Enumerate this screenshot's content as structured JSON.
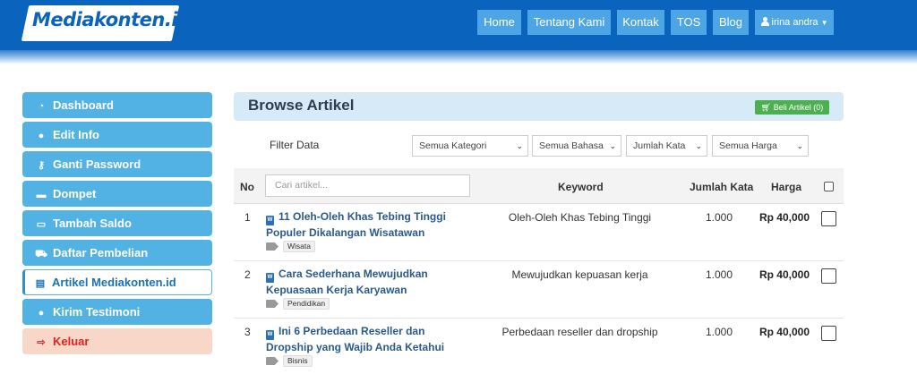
{
  "header": {
    "logo": "Mediakonten.id",
    "nav": [
      "Home",
      "Tentang Kami",
      "Kontak",
      "TOS",
      "Blog"
    ],
    "user": "irina andra"
  },
  "sidebar": {
    "items": [
      {
        "label": "Dashboard",
        "icon": "dashboard-icon"
      },
      {
        "label": "Edit Info",
        "icon": "user-icon"
      },
      {
        "label": "Ganti Password",
        "icon": "key-icon"
      },
      {
        "label": "Dompet",
        "icon": "wallet-icon"
      },
      {
        "label": "Tambah Saldo",
        "icon": "money-icon"
      },
      {
        "label": "Daftar Pembelian",
        "icon": "cart-icon"
      },
      {
        "label": "Artikel Mediakonten.id",
        "icon": "store-icon",
        "active": true
      },
      {
        "label": "Kirim Testimoni",
        "icon": "comment-icon"
      },
      {
        "label": "Keluar",
        "icon": "logout-icon"
      }
    ]
  },
  "main": {
    "title": "Browse Artikel",
    "cart_button": "Beli Artikel (0)",
    "filter_label": "Filter Data",
    "filters": [
      "Semua Kategori",
      "Semua Bahasa",
      "Jumlah Kata",
      "Semua Harga"
    ],
    "search_placeholder": "Cari artikel...",
    "columns": {
      "no": "No",
      "keyword": "Keyword",
      "words": "Jumlah Kata",
      "price": "Harga"
    },
    "rows": [
      {
        "no": "1",
        "title_1": "11 Oleh-Oleh Khas Tebing Tinggi",
        "title_2": "Populer Dikalangan Wisatawan",
        "tag": "Wisata",
        "keyword": "Oleh-Oleh Khas Tebing Tinggi",
        "words": "1.000",
        "price": "Rp 40,000"
      },
      {
        "no": "2",
        "title_1": "Cara Sederhana Mewujudkan",
        "title_2": "Kepuasaan Kerja Karyawan",
        "tag": "Pendidikan",
        "keyword": "Mewujudkan kepuasan kerja",
        "words": "1.000",
        "price": "Rp 40,000"
      },
      {
        "no": "3",
        "title_1": "Ini 6 Perbedaan Reseller dan",
        "title_2": "Dropship yang Wajib Anda Ketahui",
        "tag": "Bisnis",
        "keyword": "Perbedaan reseller dan dropship",
        "words": "1.000",
        "price": "Rp 40,000"
      }
    ]
  }
}
